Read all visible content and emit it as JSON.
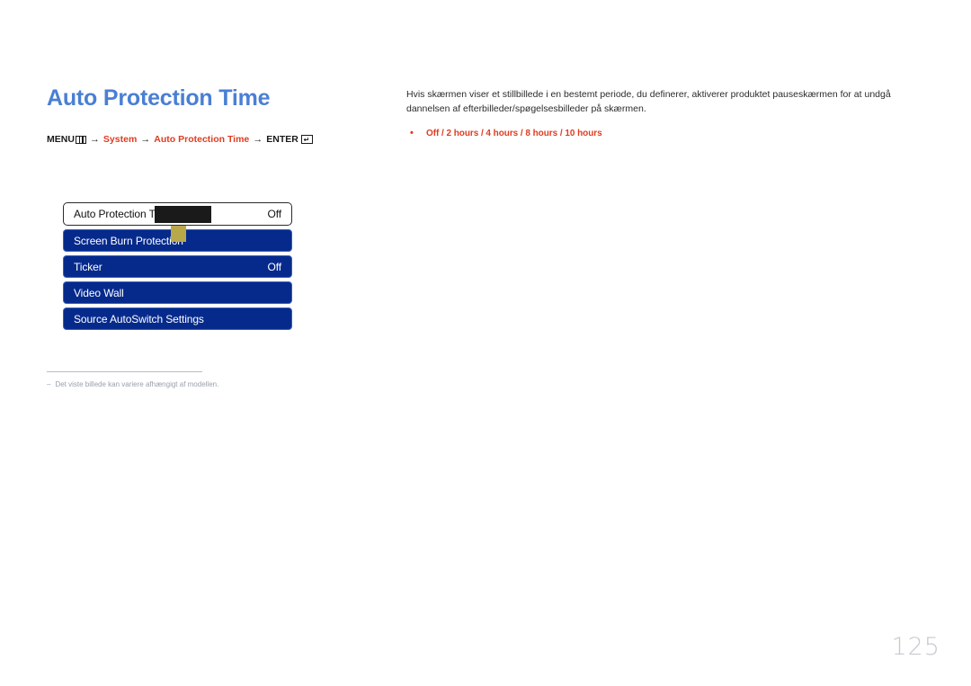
{
  "document": {
    "title": "Auto Protection Time",
    "page_number": "125"
  },
  "breadcrumb": {
    "menu_label": "MENU",
    "menu_icon": "menu-bars-icon",
    "arrow": "→",
    "step_system": "System",
    "step_feature": "Auto Protection Time",
    "enter_label": "ENTER",
    "enter_icon": "enter-return-icon"
  },
  "osd": {
    "rows": [
      {
        "label": "Auto Protection Time",
        "value": "Off",
        "state": "selected"
      },
      {
        "label": "Screen Burn Protection",
        "value": "",
        "state": "normal"
      },
      {
        "label": "Ticker",
        "value": "Off",
        "state": "normal"
      },
      {
        "label": "Video Wall",
        "value": "",
        "state": "normal"
      },
      {
        "label": "Source AutoSwitch Settings",
        "value": "",
        "state": "normal"
      }
    ],
    "colors": {
      "row_blue": "#062a8c",
      "selected_bg": "#ffffff",
      "selected_border": "#2b2b2b",
      "redaction": "#1a1a1a",
      "cursor_square": "#b8a84a"
    }
  },
  "footnote": {
    "dash": "–",
    "text": "Det viste billede kan variere afhængigt af modellen."
  },
  "description": {
    "paragraph": "Hvis skærmen viser et stillbillede i en bestemt periode, du definerer, aktiverer produktet pauseskærmen for at undgå dannelsen af efterbilleder/spøgelsesbilleder på skærmen.",
    "bullet_dot": "•",
    "options_line": "Off / 2 hours / 4 hours / 8 hours / 10 hours",
    "options": [
      "Off",
      "2 hours",
      "4 hours",
      "8 hours",
      "10 hours"
    ]
  },
  "colors": {
    "title_blue": "#4a7fd4",
    "accent_red": "#e03c20",
    "body_text": "#2b2b2b",
    "page_number": "#c6c9cf"
  }
}
